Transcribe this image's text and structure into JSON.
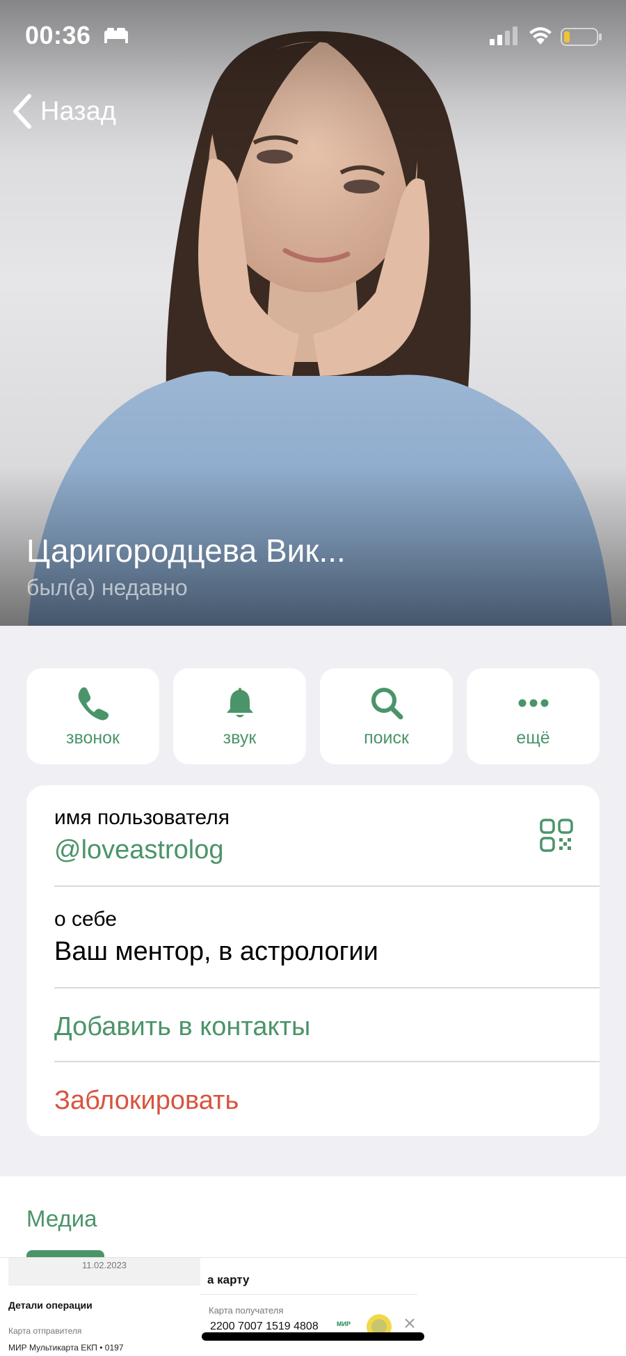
{
  "status_bar": {
    "time": "00:36"
  },
  "nav": {
    "back_label": "Назад"
  },
  "profile": {
    "name": "Царигородцева Вик...",
    "last_seen": "был(а) недавно"
  },
  "actions": [
    {
      "label": "звонок",
      "icon": "phone-icon"
    },
    {
      "label": "звук",
      "icon": "bell-icon"
    },
    {
      "label": "поиск",
      "icon": "search-icon"
    },
    {
      "label": "ещё",
      "icon": "more-icon"
    }
  ],
  "info": {
    "username_label": "имя пользователя",
    "username_value": "@loveastrolog",
    "bio_label": "о себе",
    "bio_value": "Ваш ментор, в астрологии",
    "add_contact": "Добавить в контакты",
    "block": "Заблокировать"
  },
  "media": {
    "title": "Медиа",
    "thumbnail": {
      "date": "11.02.2023",
      "heading": "Детали операции",
      "sender_label": "Карта отправителя",
      "sender_value": "МИР Мультикарта ЕКП • 0197",
      "right_title": "а карту",
      "recipient_label": "Карта получателя",
      "recipient_value": "2200 7007 1519 4808",
      "brand": "МИР"
    }
  },
  "colors": {
    "accent_green": "#4b9469",
    "danger_red": "#d9533f",
    "background": "#efeff4"
  }
}
